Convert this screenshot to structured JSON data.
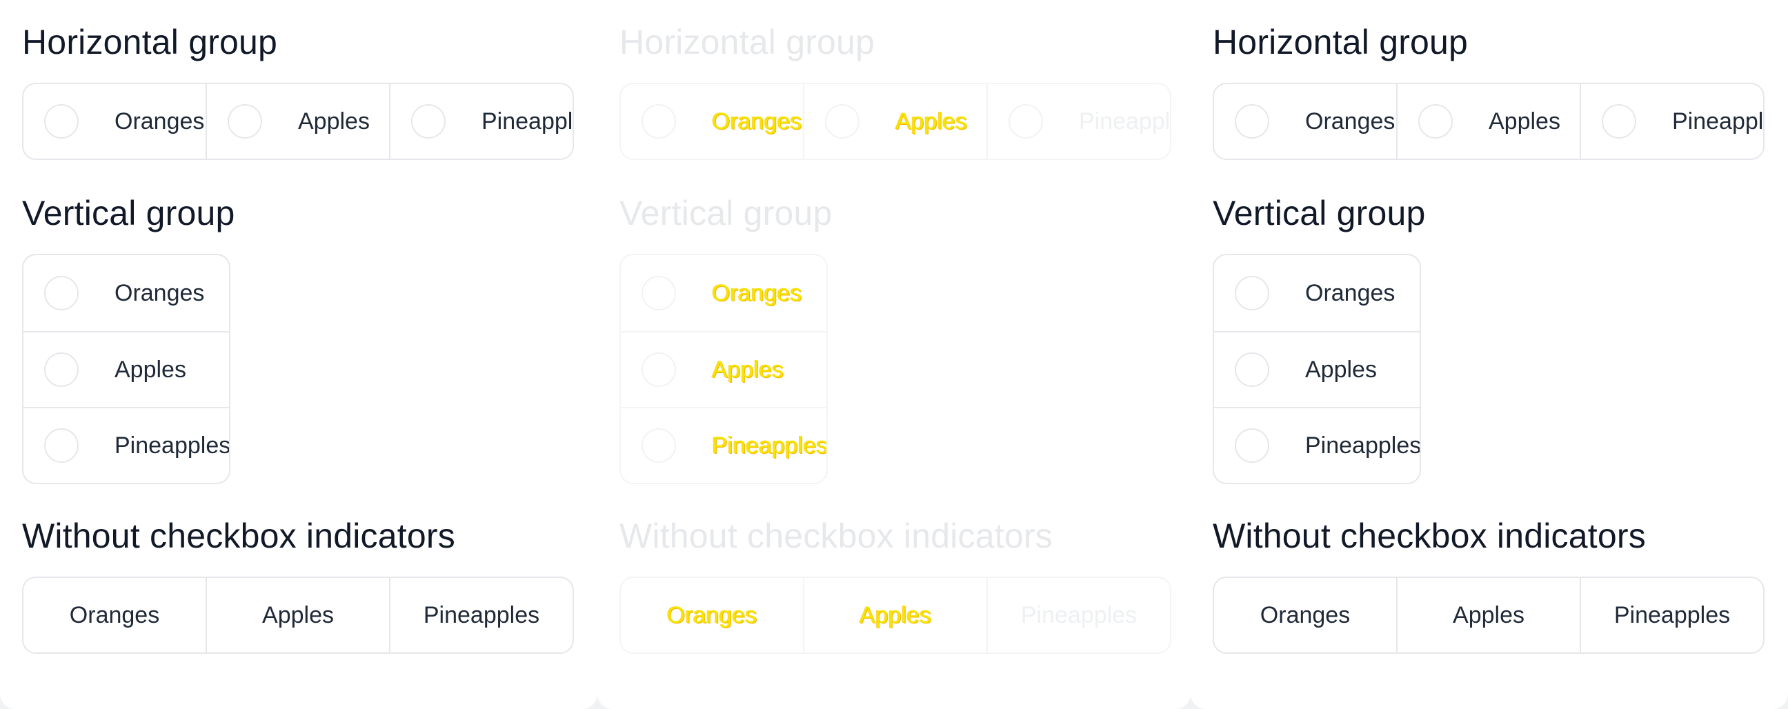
{
  "panels": [
    {
      "horizontal_title": "Horizontal group",
      "horizontal_items": [
        "Oranges",
        "Apples",
        "Pineapples"
      ],
      "vertical_title": "Vertical group",
      "vertical_items": [
        "Oranges",
        "Apples",
        "Pineapples"
      ],
      "noindicator_title": "Without checkbox indicators",
      "noindicator_items": [
        "Oranges",
        "Apples",
        "Pineapples"
      ]
    },
    {
      "horizontal_title": "Horizontal group",
      "horizontal_items": [
        "Oranges",
        "Apples",
        "Pineapples"
      ],
      "vertical_title": "Vertical group",
      "vertical_items": [
        "Oranges",
        "Apples",
        "Pineapples"
      ],
      "noindicator_title": "Without checkbox indicators",
      "noindicator_items": [
        "Oranges",
        "Apples",
        "Pineapples"
      ]
    },
    {
      "horizontal_title": "Horizontal group",
      "horizontal_items": [
        "Oranges",
        "Apples",
        "Pineapples"
      ],
      "vertical_title": "Vertical group",
      "vertical_items": [
        "Oranges",
        "Apples",
        "Pineapples"
      ],
      "noindicator_title": "Without checkbox indicators",
      "noindicator_items": [
        "Oranges",
        "Apples",
        "Pineapples"
      ]
    }
  ],
  "colors": {
    "page_background": "#f1f2f4",
    "panel_background": "#ffffff",
    "border": "#e5e7eb",
    "text": "#111827",
    "highlight": "#f5e500"
  }
}
